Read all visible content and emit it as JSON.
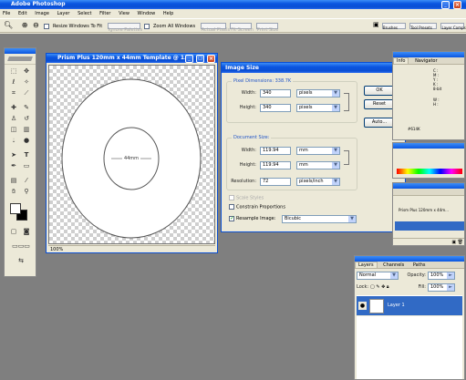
{
  "app": {
    "title": "Adobe Photoshop"
  },
  "menu": [
    "File",
    "Edit",
    "Image",
    "Layer",
    "Select",
    "Filter",
    "View",
    "Window",
    "Help"
  ],
  "options_bar": {
    "resize_windows_label": "Resize Windows To Fit",
    "ignore_palettes_label": "Ignore Palettes",
    "zoom_all_label": "Zoom All Windows",
    "actual_pixels_label": "Actual Pixels",
    "fit_screen_label": "Fit Screen",
    "print_size_label": "Print Size",
    "well_tabs": [
      "Brushes",
      "Tool Presets",
      "Layer Comps"
    ]
  },
  "document": {
    "title": "Prism Plus 120mm x 44mm Template @ 1...",
    "center_label": "44mm",
    "zoom": "100%"
  },
  "dialog": {
    "title": "Image Size",
    "pixel_dimensions_label": "Pixel Dimensions: 338.7K",
    "width_label": "Width:",
    "width_value": "340",
    "width_unit": "pixels",
    "height_label": "Height:",
    "height_value": "340",
    "height_unit": "pixels",
    "document_size_label": "Document Size:",
    "doc_width_label": "Width:",
    "doc_width_value": "119.94",
    "doc_width_unit": "mm",
    "doc_height_label": "Height:",
    "doc_height_value": "119.94",
    "doc_height_unit": "mm",
    "resolution_label": "Resolution:",
    "resolution_value": "72",
    "resolution_unit": "pixels/inch",
    "scale_styles_label": "Scale Styles",
    "constrain_label": "Constrain Proportions",
    "resample_label": "Resample Image:",
    "resample_value": "Bicubic",
    "ok_label": "OK",
    "reset_label": "Reset",
    "auto_label": "Auto..."
  },
  "navigator": {
    "tabs": [
      "Info",
      "Navigator"
    ],
    "readouts": [
      "C :",
      "M :",
      "Y :",
      "K :",
      "8-bit"
    ],
    "readout2": [
      "W :",
      "H :"
    ],
    "doc_label": "#614K"
  },
  "history": {
    "item": "Prism Plus 120mm x 44m..."
  },
  "layers": {
    "tabs": [
      "Layers",
      "Channels",
      "Paths"
    ],
    "mode": "Normal",
    "opacity_label": "Opacity:",
    "opacity": "100%",
    "lock_label": "Lock:",
    "fill_label": "Fill:",
    "fill": "100%",
    "layer_name": "Layer 1"
  }
}
